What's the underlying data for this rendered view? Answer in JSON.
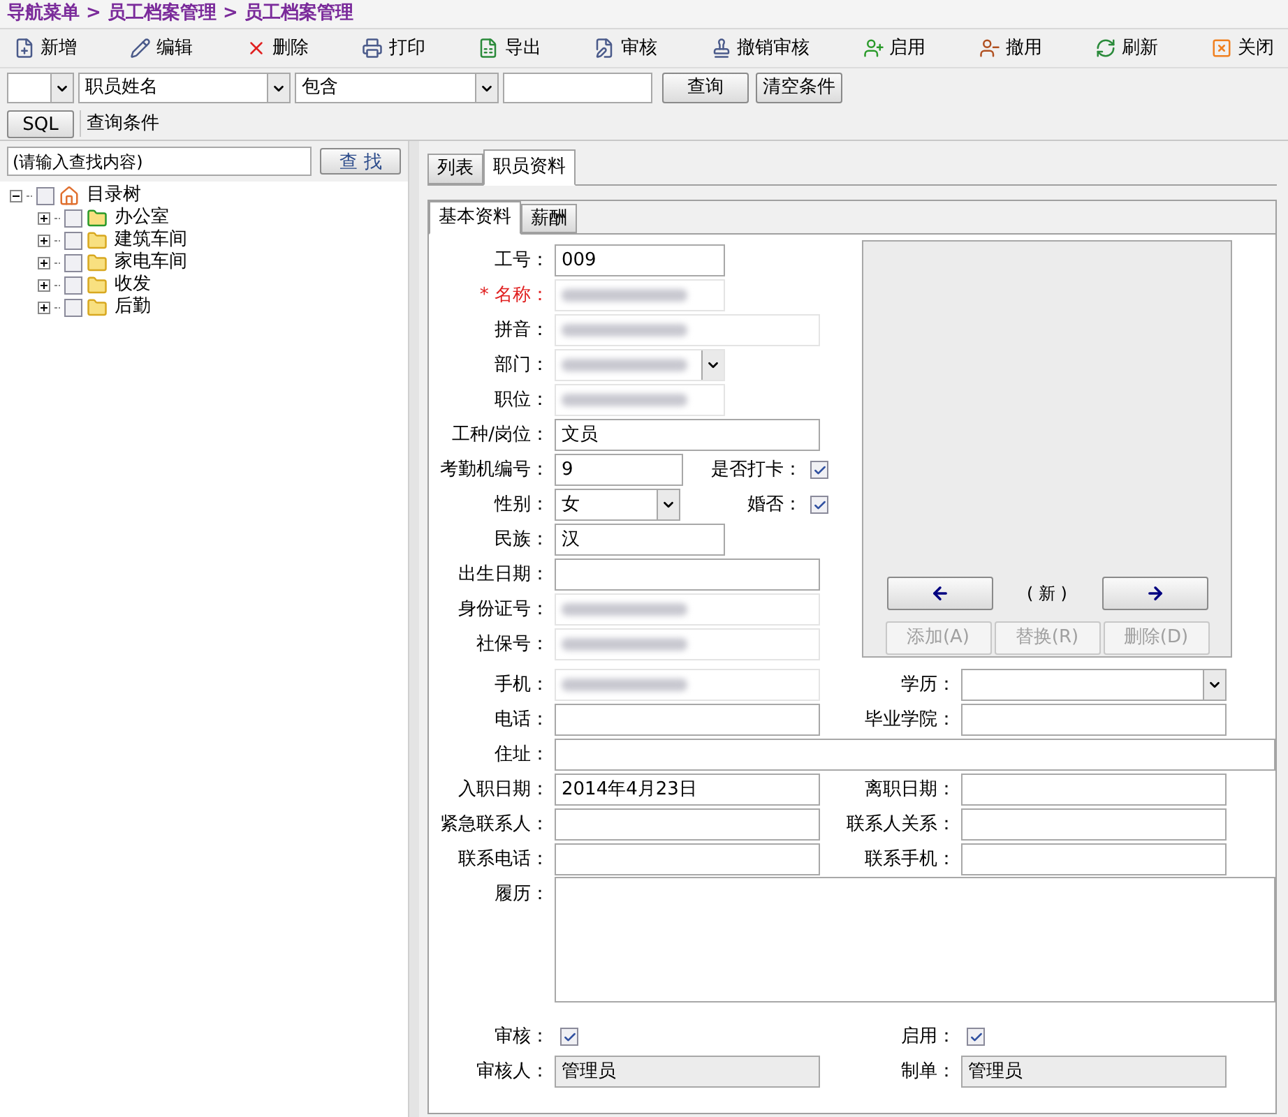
{
  "breadcrumb": "导航菜单 > 员工档案管理 > 员工档案管理",
  "toolbar": [
    {
      "label": "新增",
      "kind": "new"
    },
    {
      "label": "编辑",
      "kind": "edit"
    },
    {
      "label": "删除",
      "kind": "delete"
    },
    {
      "label": "打印",
      "kind": "print"
    },
    {
      "label": "导出",
      "kind": "export"
    },
    {
      "label": "审核",
      "kind": "audit"
    },
    {
      "label": "撤销审核",
      "kind": "unaudit"
    },
    {
      "label": "启用",
      "kind": "enable"
    },
    {
      "label": "撤用",
      "kind": "disable"
    },
    {
      "label": "刷新",
      "kind": "refresh"
    },
    {
      "label": "关闭",
      "kind": "close"
    }
  ],
  "filter": {
    "field_select": "职员姓名",
    "operator_select": "包含",
    "search_button": "查询",
    "clear_button": "清空条件"
  },
  "sql_bar": {
    "button": "SQL",
    "label": "查询条件"
  },
  "sidebar": {
    "search_placeholder": "(请输入查找内容)",
    "find_button": "查 找",
    "tree": {
      "label": "目录树",
      "checked": false,
      "expanded": true,
      "children": [
        {
          "label": "办公室",
          "checked": false,
          "expanded": false,
          "is_new": true
        },
        {
          "label": "建筑车间",
          "checked": false,
          "expanded": false,
          "is_new": false
        },
        {
          "label": "家电车间",
          "checked": false,
          "expanded": false,
          "is_new": false
        },
        {
          "label": "收发",
          "checked": false,
          "expanded": false,
          "is_new": false
        },
        {
          "label": "后勤",
          "checked": false,
          "expanded": false,
          "is_new": false
        }
      ]
    }
  },
  "tabs": [
    {
      "label": "列表",
      "selected": false
    },
    {
      "label": "职员资料",
      "selected": true
    }
  ],
  "sub_tabs": [
    {
      "label": "基本资料",
      "selected": true
    },
    {
      "label": "薪酬",
      "selected": false
    }
  ],
  "form": {
    "top_rows": [
      {
        "label": "工号：",
        "kind": "text",
        "value": "009",
        "required": false
      },
      {
        "label": "* 名称：",
        "kind": "text",
        "blurred": true,
        "required": true
      },
      {
        "label": "拼音：",
        "kind": "text",
        "blurred": true,
        "required": false
      },
      {
        "label": "部门：",
        "kind": "select",
        "blurred": true,
        "required": false
      },
      {
        "label": "职位：",
        "kind": "text",
        "blurred": true,
        "required": false
      },
      {
        "label": "工种/岗位：",
        "kind": "text",
        "value": "文员",
        "required": false
      },
      {
        "label": "考勤机编号：",
        "kind": "text",
        "value": "9",
        "required": false,
        "extra": {
          "label": "是否打卡：",
          "checked": true
        }
      },
      {
        "label": "性别：",
        "kind": "select",
        "value": "女",
        "required": false,
        "extra": {
          "label": "婚否：",
          "checked": true
        }
      },
      {
        "label": "民族：",
        "kind": "text",
        "value": "汉",
        "required": false
      },
      {
        "label": "出生日期：",
        "kind": "text",
        "required": false
      },
      {
        "label": "身份证号：",
        "kind": "text",
        "blurred": true,
        "required": false
      },
      {
        "label": "社保号：",
        "kind": "text",
        "blurred": true,
        "required": false
      }
    ],
    "photo": {
      "caption": "( 新 )",
      "buttons": [
        {
          "label": "添加(A)",
          "disabled": true
        },
        {
          "label": "替换(R)",
          "disabled": true
        },
        {
          "label": "删除(D)",
          "disabled": true
        }
      ]
    },
    "bottom_rows": [
      {
        "left": {
          "label": "手机：",
          "kind": "text",
          "blurred": true
        },
        "right": {
          "label": "学历：",
          "kind": "select"
        }
      },
      {
        "left": {
          "label": "电话：",
          "kind": "text"
        },
        "right": {
          "label": "毕业学院：",
          "kind": "text"
        }
      },
      {
        "left": {
          "label": "住址：",
          "kind": "text"
        }
      },
      {
        "left": {
          "label": "入职日期：",
          "kind": "text",
          "value": "2014年4月23日"
        },
        "right": {
          "label": "离职日期：",
          "kind": "text"
        }
      },
      {
        "left": {
          "label": "紧急联系人：",
          "kind": "text"
        },
        "right": {
          "label": "联系人关系：",
          "kind": "text"
        }
      },
      {
        "left": {
          "label": "联系电话：",
          "kind": "text"
        },
        "right": {
          "label": "联系手机：",
          "kind": "text"
        }
      },
      {
        "left": {
          "label": "履历：",
          "kind": "textarea"
        }
      },
      {
        "left": {
          "label": "审核：",
          "kind": "checkbox",
          "checked": true
        },
        "right": {
          "label": "启用：",
          "kind": "checkbox",
          "checked": true
        }
      },
      {
        "left": {
          "label": "审核人：",
          "kind": "readonly",
          "value": "管理员"
        },
        "right": {
          "label": "制单：",
          "kind": "readonly",
          "value": "管理员"
        }
      }
    ]
  }
}
